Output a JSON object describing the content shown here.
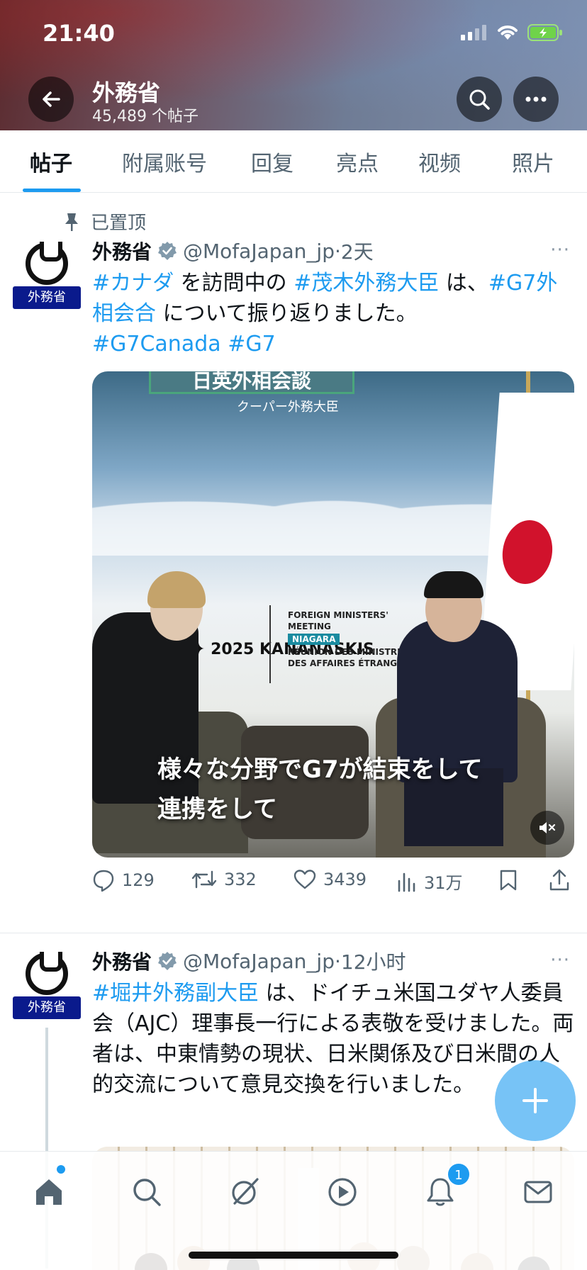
{
  "status_bar": {
    "time": "21:40"
  },
  "header": {
    "title": "外務省",
    "subtitle": "45,489 个帖子"
  },
  "tabs": [
    {
      "label": "帖子"
    },
    {
      "label": "附属账号"
    },
    {
      "label": "回复"
    },
    {
      "label": "亮点"
    },
    {
      "label": "视频"
    },
    {
      "label": "照片"
    }
  ],
  "posts": [
    {
      "pinned_label": "已置顶",
      "avatar_label": "外務省",
      "name": "外務省",
      "handle": "@MofaJapan_jp",
      "dot": "·",
      "time": "2天",
      "more": "···",
      "text": {
        "tag1": "#カナダ",
        "t1": " を訪問中の ",
        "tag2": "#茂木外務大臣",
        "t2": " は、",
        "tag3": "#G7外相会合",
        "t3": " について振り返りました。",
        "tag4": "#G7Canada",
        "tag5": "#G7"
      },
      "media": {
        "banner": "日英外相会談",
        "caption": "クーパー外務大臣",
        "logo_text": "G7 ✦ 2025 KANANASKIS",
        "meeting_line1": "FOREIGN MINISTERS' MEETING",
        "meeting_badge": "NIAGARA",
        "meeting_line2": "RÉUNION DES MINISTRES DES AFFAIRES ÉTRANGÈRES",
        "subtitle_line1": "様々な分野でG7が結束をして",
        "subtitle_line2": "連携をして"
      },
      "stats": {
        "replies": "129",
        "reposts": "332",
        "likes": "3439",
        "views": "31万"
      }
    },
    {
      "avatar_label": "外務省",
      "name": "外務省",
      "handle": "@MofaJapan_jp",
      "dot": "·",
      "time": "12小时",
      "more": "···",
      "text": {
        "tag1": "#堀井外務副大臣",
        "t1": " は、ドイチュ米国ユダヤ人委員会（AJC）理事長一行による表敬を受けました。両者は、中東情勢の現状、日米関係及び日米間の人的交流について意見交換を行いました。"
      }
    }
  ],
  "bottom_nav": {
    "notification_badge": "1"
  },
  "icons": [
    "back-arrow-icon",
    "search-icon",
    "more-icon",
    "pin-icon",
    "verified-icon",
    "reply-icon",
    "repost-icon",
    "like-icon",
    "views-icon",
    "bookmark-icon",
    "share-icon",
    "mute-icon",
    "plus-icon",
    "home-icon",
    "grok-icon",
    "video-icon",
    "bell-icon",
    "mail-icon"
  ],
  "colors": {
    "accent": "#1d9bf0",
    "text": "#0f1419",
    "secondary": "#536471",
    "avatar_label_bg": "#0a1a8c"
  }
}
